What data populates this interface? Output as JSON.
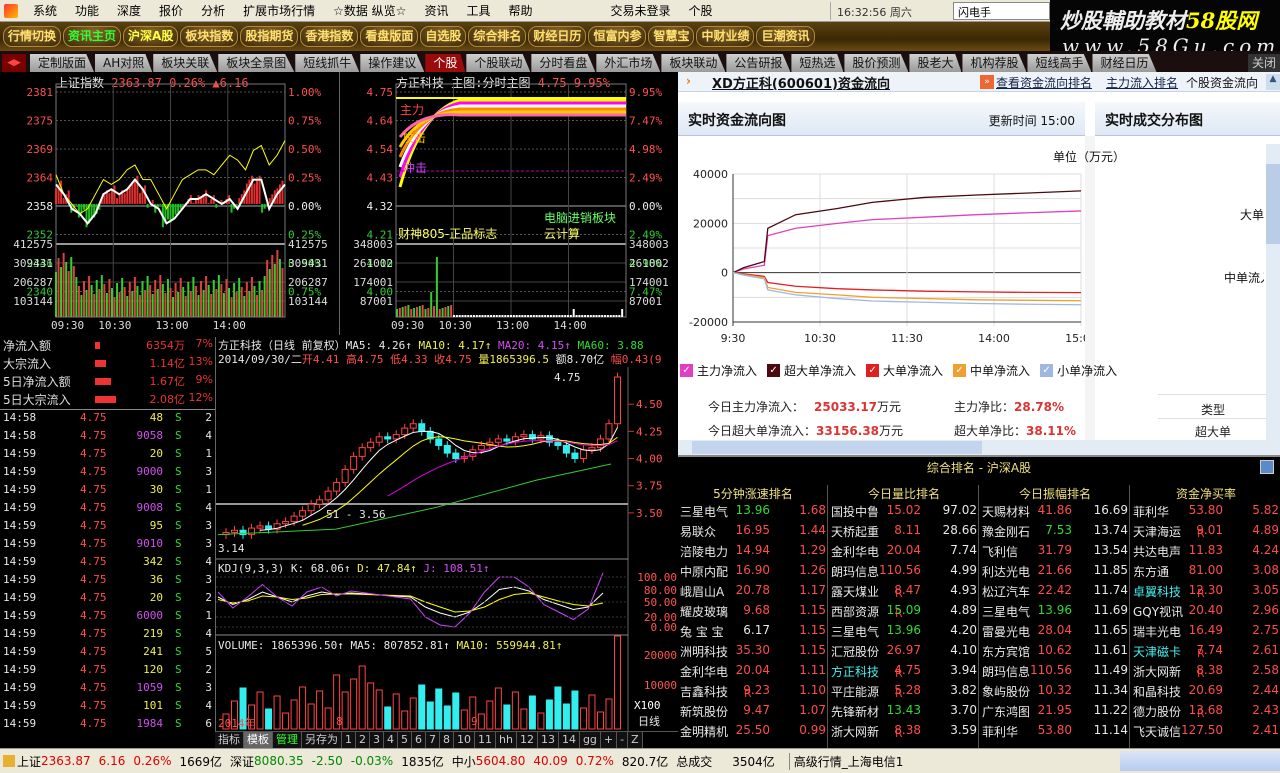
{
  "menu": {
    "items": [
      "系统",
      "功能",
      "深度",
      "报价",
      "分析",
      "扩展市场行情",
      "☆数据 纵览☆",
      "资讯",
      "工具",
      "帮助"
    ],
    "login": "交易未登录",
    "mode": "个股",
    "clock": "16:32:56 周六",
    "flash": "闪电手"
  },
  "watermark": {
    "line1a": "炒股輔助教材",
    "line1b": "58股网",
    "line2": "www.58Gu.com"
  },
  "toolbar": {
    "buttons": [
      "行情切换",
      "资讯主页",
      "沪深A股",
      "板块指数",
      "股指期货",
      "香港指数",
      "看盘版面",
      "自选股",
      "综合排名",
      "财经日历",
      "恒富内参",
      "智慧宝",
      "中财业绩",
      "巨潮资讯"
    ]
  },
  "tabs": {
    "items": [
      "定制版面",
      "AH对照",
      "板块关联",
      "板块全景图",
      "短线抓牛",
      "操作建议",
      "个股",
      "个股联动",
      "分时看盘",
      "外汇市场",
      "板块联动",
      "公告研报",
      "短热选",
      "股价预测",
      "股老大",
      "机构荐股",
      "短线高手",
      "财经日历"
    ],
    "active": 6,
    "close": "关闭"
  },
  "index_chart": {
    "title": "上证指数",
    "price": "2363.87",
    "pct": "0.26%",
    "chg": "▲6.16",
    "y_left": [
      "2381",
      "2375",
      "2369",
      "2364",
      "2358",
      "2352",
      "2346",
      "2340"
    ],
    "y_right": [
      "1.00%",
      "0.75%",
      "0.50%",
      "0.25%",
      "0.00%",
      "0.25%",
      "0.50%",
      "0.75%"
    ],
    "vol_left": [
      "412575",
      "309431",
      "206287",
      "103144"
    ],
    "vol_right": [
      "412575",
      "309431",
      "206287",
      "103144"
    ],
    "times": [
      "09:30",
      "10:30",
      "13:00",
      "14:00"
    ],
    "line": [
      2362,
      2360,
      2357,
      2356,
      2354,
      2356,
      2360,
      2361,
      2360,
      2361,
      2363,
      2361,
      2358,
      2357,
      2354,
      2355,
      2357,
      2359,
      2359,
      2360,
      2359,
      2358,
      2359,
      2357,
      2360,
      2363,
      2363,
      2357,
      2360,
      2362
    ],
    "avg": [
      2364,
      2360,
      2358,
      2356,
      2357,
      2360,
      2363,
      2362,
      2363,
      2365,
      2366,
      2363,
      2363,
      2360,
      2357,
      2360,
      2363,
      2364,
      2365,
      2365,
      2364,
      2366,
      2368,
      2367,
      2365,
      2369,
      2370,
      2366,
      2368,
      2371
    ]
  },
  "stock_chart": {
    "title": "方正科技",
    "mode": "主图:分时主图",
    "price": "4.75",
    "pct": "9.95%",
    "y_left": [
      "4.75",
      "4.64",
      "4.54",
      "4.43",
      "4.32",
      "4.21",
      "4.10",
      "4.00"
    ],
    "y_right": [
      "9.95%",
      "7.47%",
      "4.98%",
      "2.49%",
      "0.00%",
      "2.49%",
      "4.98%",
      "7.47%"
    ],
    "vol_left": [
      "348003",
      "261002",
      "174001",
      "87001"
    ],
    "vol_right": [
      "348003",
      "261002",
      "174001",
      "87001"
    ],
    "times": [
      "09:30",
      "10:30",
      "13:00",
      "14:00"
    ],
    "notes": [
      "财神805-正品标志",
      "电脑进销板块",
      "云计算"
    ],
    "overlay": [
      "主力",
      "攻击",
      "冲击"
    ]
  },
  "fund_flow": {
    "rows": [
      {
        "label": "净流入额",
        "value": "6354万",
        "pct": "7%",
        "bar": 0.15
      },
      {
        "label": "大宗流入",
        "value": "1.14亿",
        "pct": "13%",
        "bar": 0.3
      },
      {
        "label": "5日净流入额",
        "value": "1.67亿",
        "pct": "9%",
        "bar": 0.45
      },
      {
        "label": "5日大宗流入",
        "value": "2.08亿",
        "pct": "12%",
        "bar": 0.6
      }
    ]
  },
  "ticks": [
    [
      "14:58",
      "4.75",
      "48",
      "S",
      "2",
      0
    ],
    [
      "14:58",
      "4.75",
      "9058",
      "S",
      "4",
      1
    ],
    [
      "14:59",
      "4.75",
      "20",
      "S",
      "1",
      0
    ],
    [
      "14:59",
      "4.75",
      "9000",
      "S",
      "3",
      1
    ],
    [
      "14:59",
      "4.75",
      "30",
      "S",
      "1",
      0
    ],
    [
      "14:59",
      "4.75",
      "9008",
      "S",
      "4",
      1
    ],
    [
      "14:59",
      "4.75",
      "95",
      "S",
      "3",
      0
    ],
    [
      "14:59",
      "4.75",
      "9010",
      "S",
      "3",
      1
    ],
    [
      "14:59",
      "4.75",
      "342",
      "S",
      "4",
      0
    ],
    [
      "14:59",
      "4.75",
      "36",
      "S",
      "3",
      0
    ],
    [
      "14:59",
      "4.75",
      "20",
      "S",
      "2",
      0
    ],
    [
      "14:59",
      "4.75",
      "6000",
      "S",
      "1",
      1
    ],
    [
      "14:59",
      "4.75",
      "219",
      "S",
      "4",
      0
    ],
    [
      "14:59",
      "4.75",
      "241",
      "S",
      "5",
      0
    ],
    [
      "14:59",
      "4.75",
      "120",
      "S",
      "2",
      0
    ],
    [
      "14:59",
      "4.75",
      "1059",
      "S",
      "3",
      1
    ],
    [
      "14:59",
      "4.75",
      "101",
      "S",
      "4",
      0
    ],
    [
      "14:59",
      "4.75",
      "1984",
      "S",
      "6",
      1
    ]
  ],
  "kline": {
    "title": "方正科技（日线 前复权）",
    "ma5": "MA5: 4.26↑",
    "ma10": "MA10: 4.17↑",
    "ma20": "MA20: 4.15↑",
    "ma60": "MA60: 3.88",
    "date": "2014/09/30/二",
    "open": "开4.41",
    "high": "高4.75",
    "low": "低4.33",
    "close": "收4.75",
    "vol": "量1865396.5",
    "amt": "额8.70亿",
    "amp": "幅0.43(9",
    "y": [
      "4.50",
      "4.25",
      "4.00",
      "3.75",
      "3.50"
    ],
    "hi_label": "4.75",
    "lo_label": "3.14",
    "range_label": "51 - 3.56",
    "date_labels": [
      "2014年",
      "8",
      "9"
    ],
    "period": "日线",
    "closes": [
      3.32,
      3.34,
      3.3,
      3.36,
      3.38,
      3.35,
      3.4,
      3.42,
      3.47,
      3.52,
      3.58,
      3.62,
      3.7,
      3.78,
      3.9,
      4.02,
      4.1,
      4.15,
      4.2,
      4.18,
      4.22,
      4.28,
      4.32,
      4.25,
      4.18,
      4.12,
      4.05,
      4.0,
      4.02,
      4.08,
      4.12,
      4.15,
      4.18,
      4.16,
      4.2,
      4.22,
      4.18,
      4.21,
      4.15,
      4.12,
      4.05,
      4.0,
      4.08,
      4.1,
      4.18,
      4.32,
      4.75
    ]
  },
  "kdj": {
    "label": "KDJ(9,3,3)",
    "k": "K: 68.06↑",
    "d": "D: 47.84↑",
    "j": "J: 108.51↑",
    "y": [
      "100.00",
      "80.00",
      "50.00",
      "20.00",
      "0.00"
    ],
    "kv": [
      60,
      45,
      55,
      70,
      60,
      50,
      62,
      70,
      65,
      68,
      66,
      64,
      62,
      60,
      40,
      28,
      20,
      30,
      50,
      75,
      80,
      72,
      55,
      45,
      35,
      40,
      68
    ],
    "dv": [
      55,
      48,
      52,
      62,
      60,
      55,
      58,
      65,
      66,
      66,
      65,
      64,
      63,
      62,
      50,
      40,
      30,
      32,
      40,
      55,
      65,
      68,
      60,
      52,
      45,
      42,
      48
    ],
    "jv": [
      70,
      38,
      60,
      85,
      60,
      42,
      70,
      80,
      62,
      72,
      68,
      64,
      60,
      56,
      20,
      4,
      0,
      28,
      70,
      100,
      100,
      80,
      45,
      30,
      15,
      36,
      108
    ]
  },
  "volume": {
    "label": "VOLUME: 1865396.50↑",
    "ma5": "MA5: 807852.81↑",
    "ma10": "MA10: 559944.81↑",
    "y": [
      "20000",
      "10000",
      "X100"
    ]
  },
  "bottom_tabs": [
    "指标",
    "模板",
    "管理",
    "另存为",
    "1",
    "2",
    "3",
    "4",
    "5",
    "6",
    "7",
    "8",
    "10",
    "11",
    "hh",
    "12",
    "13",
    "14",
    "gg",
    "+",
    "-",
    "Z"
  ],
  "web": {
    "title": "XD方正科(600601)资金流向",
    "links": [
      "查看资金流向排名",
      "主力流入排名"
    ],
    "link3": "个股资金流向",
    "chart_title": "实时资金流向图",
    "update_label": "更新时间",
    "update_time": "15:00",
    "unit": "单位（万元）",
    "right_title": "实时成交分布图",
    "right_labels": [
      "大单",
      "中单流入"
    ],
    "type_label": "类型",
    "type_value": "超大单",
    "stats": {
      "l1": "今日主力净流入：",
      "v1": "25033.17",
      "u1": "万元",
      "l2": "主力净比：",
      "v2": "28.78%",
      "l3": "今日超大单净流入：",
      "v3": "33156.38",
      "u3": "万元",
      "l4": "超大单净比：",
      "v4": "38.11%"
    }
  },
  "chart_data": {
    "type": "line",
    "title": "实时资金流向图",
    "ylabel": "单位（万元）",
    "ylim": [
      -20000,
      40000
    ],
    "yticks": [
      "40000",
      "20000",
      "0",
      "-20000"
    ],
    "xticks": [
      "9:30",
      "10:30",
      "11:30",
      "14:00",
      "15:00"
    ],
    "series": [
      {
        "name": "主力净流入",
        "color": "#e040c0",
        "values": [
          0,
          1500,
          3000,
          15000,
          18000,
          20000,
          21500,
          22500,
          23500,
          24300,
          25033
        ]
      },
      {
        "name": "超大单净流入",
        "color": "#4a0a10",
        "values": [
          0,
          2000,
          4500,
          18000,
          23500,
          26000,
          28500,
          30500,
          31500,
          32300,
          33156
        ]
      },
      {
        "name": "大单净流入",
        "color": "#e02020",
        "values": [
          0,
          -500,
          -1500,
          -4000,
          -5500,
          -6500,
          -7000,
          -7500,
          -7800,
          -8000,
          -8100
        ]
      },
      {
        "name": "中单净流入",
        "color": "#f0a030",
        "values": [
          0,
          -800,
          -2000,
          -6000,
          -8000,
          -9000,
          -10000,
          -10500,
          -11000,
          -11200,
          -11400
        ]
      },
      {
        "name": "小单净流入",
        "color": "#a0b8e0",
        "values": [
          0,
          -1000,
          -2500,
          -7000,
          -9000,
          -10500,
          -11500,
          -12000,
          -12500,
          -12800,
          -13000
        ]
      }
    ]
  },
  "ranking": {
    "title": "综合排名 - 沪深A股",
    "columns": [
      {
        "header": "5分钟涨速排名",
        "rows": [
          [
            "三星电气",
            "13.96",
            "1.68",
            "",
            ""
          ],
          [
            "易联众",
            "16.95",
            "1.44",
            "",
            ""
          ],
          [
            "涪陵电力",
            "14.94",
            "1.29",
            "",
            ""
          ],
          [
            "中原内配",
            "16.90",
            "1.26",
            "",
            ""
          ],
          [
            "峨眉山A",
            "20.78",
            "1.17",
            "",
            ""
          ],
          [
            "耀皮玻璃",
            "9.68",
            "1.15",
            "",
            ""
          ],
          [
            "兔 宝 宝",
            "6.17",
            "1.15",
            "",
            ""
          ],
          [
            "洲明科技",
            "35.30",
            "1.15",
            "",
            ""
          ],
          [
            "金利华电",
            "20.04",
            "1.11",
            "",
            ""
          ],
          [
            "吉鑫科技",
            "9.23",
            "1.10",
            "R",
            ""
          ],
          [
            "新筑股份",
            "9.47",
            "1.07",
            "",
            ""
          ],
          [
            "金明精机",
            "25.50",
            "0.99",
            "",
            ""
          ]
        ]
      },
      {
        "header": "今日量比排名",
        "rows": [
          [
            "国投中鲁",
            "15.02",
            "97.02",
            "",
            ""
          ],
          [
            "天桥起重",
            "8.11",
            "28.66",
            "",
            ""
          ],
          [
            "金利华电",
            "20.04",
            "7.74",
            "",
            ""
          ],
          [
            "朗玛信息",
            "110.56",
            "4.99",
            "",
            ""
          ],
          [
            "露天煤业",
            "8.47",
            "4.93",
            "R",
            ""
          ],
          [
            "西部资源",
            "15.09",
            "4.89",
            "R",
            ""
          ],
          [
            "三星电气",
            "13.96",
            "4.20",
            "",
            ""
          ],
          [
            "汇冠股份",
            "26.97",
            "4.10",
            "",
            ""
          ],
          [
            "方正科技",
            "4.75",
            "3.94",
            "R",
            "c"
          ],
          [
            "平庄能源",
            "5.28",
            "3.82",
            "R",
            ""
          ],
          [
            "先锋新材",
            "13.43",
            "3.70",
            "",
            ""
          ],
          [
            "浙大网新",
            "8.38",
            "3.59",
            "R",
            ""
          ]
        ]
      },
      {
        "header": "今日振幅排名",
        "rows": [
          [
            "天赐材料",
            "41.86",
            "16.69",
            "",
            ""
          ],
          [
            "豫金刚石",
            "7.53",
            "13.74",
            "",
            ""
          ],
          [
            "飞利信",
            "31.79",
            "13.54",
            "",
            ""
          ],
          [
            "利达光电",
            "21.66",
            "11.85",
            "",
            ""
          ],
          [
            "松辽汽车",
            "22.42",
            "11.74",
            "",
            ""
          ],
          [
            "三星电气",
            "13.96",
            "11.69",
            "",
            ""
          ],
          [
            "雷曼光电",
            "28.04",
            "11.65",
            "",
            ""
          ],
          [
            "东方宾馆",
            "10.62",
            "11.61",
            "",
            ""
          ],
          [
            "朗玛信息",
            "110.56",
            "11.49",
            "",
            ""
          ],
          [
            "象屿股份",
            "10.32",
            "11.34",
            "",
            ""
          ],
          [
            "广东鸿图",
            "21.95",
            "11.22",
            "",
            ""
          ],
          [
            "菲利华",
            "53.80",
            "11.14",
            "",
            ""
          ]
        ]
      },
      {
        "header": "资金净买率",
        "rows": [
          [
            "菲利华",
            "53.80",
            "5.82",
            "",
            ""
          ],
          [
            "天津海运",
            "9.01",
            "4.89",
            "R",
            ""
          ],
          [
            "共达电声",
            "11.83",
            "4.24",
            "",
            ""
          ],
          [
            "东方通",
            "81.00",
            "3.08",
            "",
            ""
          ],
          [
            "卓翼科技",
            "12.30",
            "3.05",
            "R",
            "c"
          ],
          [
            "GQY视讯",
            "20.40",
            "2.96",
            "",
            ""
          ],
          [
            "瑞丰光电",
            "16.49",
            "2.75",
            "",
            ""
          ],
          [
            "天津磁卡",
            "7.74",
            "2.61",
            "R",
            "c"
          ],
          [
            "浙大网新",
            "8.38",
            "2.58",
            "R",
            ""
          ],
          [
            "和晶科技",
            "20.69",
            "2.44",
            "",
            ""
          ],
          [
            "德力股份",
            "13.68",
            "2.43",
            "R",
            ""
          ],
          [
            "飞天诚信",
            "127.50",
            "2.41",
            "",
            ""
          ]
        ]
      }
    ]
  },
  "green_prices": [
    "13.96",
    "7.53",
    "13.43",
    "15.09"
  ],
  "status": {
    "sh_label": "上证",
    "sh": "2363.87",
    "sh_chg": "6.16",
    "sh_pct": "0.26%",
    "sh_amt": "1669亿",
    "sz_label": "深证",
    "sz": "8080.35",
    "sz_chg": "-2.50",
    "sz_pct": "-0.03%",
    "sz_amt": "1835亿",
    "zx_label": "中小",
    "zx": "5604.80",
    "zx_chg": "40.09",
    "zx_pct": "0.72%",
    "zx_amt": "820.7亿",
    "total_label": "总成交",
    "total": "3504亿",
    "server": "高级行情_上海电信1"
  }
}
